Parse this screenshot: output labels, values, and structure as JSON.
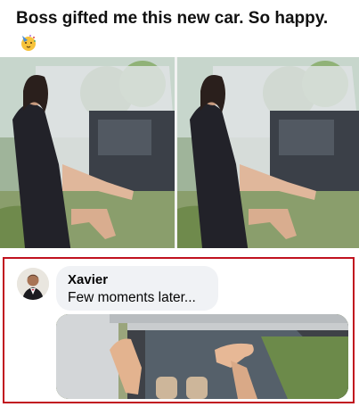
{
  "post": {
    "caption": "Boss gifted me this new car. So happy.",
    "emoji_icon": "partying-face-icon"
  },
  "comment": {
    "author": "Xavier",
    "text": "Few moments later..."
  },
  "colors": {
    "highlight_border": "#c1121f",
    "bubble_background": "#f0f2f5"
  }
}
